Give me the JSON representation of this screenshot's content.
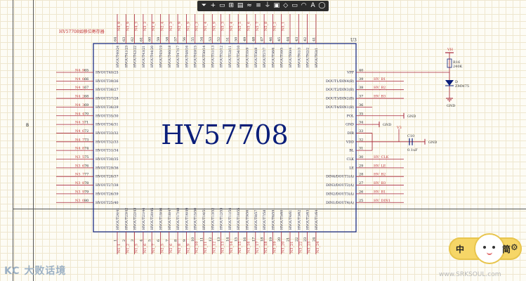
{
  "toolbar": {
    "tools": [
      {
        "name": "filter-tool",
        "glyph": "⏷"
      },
      {
        "name": "move-tool",
        "glyph": "+"
      },
      {
        "name": "select-tool",
        "glyph": "▭"
      },
      {
        "name": "align-tool",
        "glyph": "⊞"
      },
      {
        "name": "component-tool",
        "glyph": "▤"
      },
      {
        "name": "wire-tool",
        "glyph": "≈"
      },
      {
        "name": "bus-tool",
        "glyph": "≡"
      },
      {
        "name": "power-tool",
        "glyph": "⏚"
      },
      {
        "name": "port-tool",
        "glyph": "▣"
      },
      {
        "name": "directive-tool",
        "glyph": "◇"
      },
      {
        "name": "harness-tool",
        "glyph": "▭"
      },
      {
        "name": "arc-tool",
        "glyph": "◠"
      },
      {
        "name": "text-tool",
        "glyph": "A"
      },
      {
        "name": "shape-tool",
        "glyph": "◯"
      }
    ]
  },
  "sheet": {
    "zone_letter": "B"
  },
  "chip": {
    "title": "HV57708",
    "designator": "U3",
    "heading": "HV57708如移位寄存器",
    "colors": {
      "body": "#0b1e7a",
      "wire": "#a8263a",
      "net": "#c03030",
      "pinnum": "#222222",
      "pintext": "#1a1a3a"
    }
  },
  "top_pins": [
    {
      "num": "64",
      "pin": "HVOUT40/24",
      "net": "N4_9"
    },
    {
      "num": "63",
      "pin": "HVOUT41/23",
      "net": "N3_9"
    },
    {
      "num": "62",
      "pin": "HVOUT42/22",
      "net": "N4_3"
    },
    {
      "num": "61",
      "pin": "HVOUT43/21",
      "net": "N3_3"
    },
    {
      "num": "60",
      "pin": "HVOUT44/20",
      "net": "N3_4"
    },
    {
      "num": "59",
      "pin": "HVOUT45/19",
      "net": "N2_4"
    },
    {
      "num": "58",
      "pin": "HVOUT46/18",
      "net": "N2_3"
    },
    {
      "num": "57",
      "pin": "HVOUT47/17",
      "net": "N2_9"
    },
    {
      "num": "56",
      "pin": "HVOUT48/16",
      "net": "N1_9"
    },
    {
      "num": "55",
      "pin": "HVOUT49/15",
      "net": "N1_3"
    },
    {
      "num": "54",
      "pin": "HVOUT50/14",
      "net": "N1_4"
    },
    {
      "num": "53",
      "pin": "HVOUT51/13",
      "net": "N5_9"
    },
    {
      "num": "52",
      "pin": "HVOUT52/12",
      "net": "N5_3"
    },
    {
      "num": "51",
      "pin": "HVOUT53/11",
      "net": "N5_4"
    },
    {
      "num": "50",
      "pin": "HVOUT54/10",
      "net": "N5_5"
    },
    {
      "num": "49",
      "pin": "HVOUT55/9",
      "net": "N5_6"
    },
    {
      "num": "48",
      "pin": "HVOUT56/8",
      "net": "N5_7"
    },
    {
      "num": "47",
      "pin": "HVOUT57/7",
      "net": "N5_8"
    },
    {
      "num": "46",
      "pin": "HVOUT58/6",
      "net": "N5_2"
    },
    {
      "num": "45",
      "pin": "HVOUT59/5",
      "net": "N5_1"
    },
    {
      "num": "44",
      "pin": "HVOUT60/4",
      "net": ""
    },
    {
      "num": "43",
      "pin": "HVOUT61/3",
      "net": ""
    },
    {
      "num": "42",
      "pin": "HVOUT62/2",
      "net": ""
    },
    {
      "num": "41",
      "pin": "HVOUT63/1",
      "net": ""
    }
  ],
  "bottom_pins": [
    {
      "num": "1",
      "pin": "HVOUT24/41",
      "net": "N1_1"
    },
    {
      "num": "2",
      "pin": "HVOUT23/42",
      "net": "N1_2"
    },
    {
      "num": "3",
      "pin": "HVOUT22/43",
      "net": "N1_5"
    },
    {
      "num": "4",
      "pin": "HVOUT21/44",
      "net": "N1_6"
    },
    {
      "num": "5",
      "pin": "HVOUT20/45",
      "net": "N1_7"
    },
    {
      "num": "6",
      "pin": "HVOUT19/46",
      "net": "N2_5"
    },
    {
      "num": "7",
      "pin": "HVOUT18/47",
      "net": "N2_6"
    },
    {
      "num": "8",
      "pin": "HVOUT17/48",
      "net": "N2_8"
    },
    {
      "num": "9",
      "pin": "HVOUT16/49",
      "net": "N2_9"
    },
    {
      "num": "10",
      "pin": "HVOUT15/50",
      "net": "N2_10"
    },
    {
      "num": "11",
      "pin": "HVOUT14/51",
      "net": "N3_11"
    },
    {
      "num": "12",
      "pin": "HVOUT13/52",
      "net": "N3_12"
    },
    {
      "num": "13",
      "pin": "HVOUT12/53",
      "net": "N3_13"
    },
    {
      "num": "14",
      "pin": "HVOUT11/54",
      "net": "N3_14"
    },
    {
      "num": "15",
      "pin": "HVOUT10/55",
      "net": "N3_15"
    },
    {
      "num": "16",
      "pin": "HVOUT9/56",
      "net": "N3_16"
    },
    {
      "num": "17",
      "pin": "HVOUT8/57",
      "net": "N3_17"
    },
    {
      "num": "18",
      "pin": "HVOUT7/58",
      "net": "N3_18"
    },
    {
      "num": "19",
      "pin": "HVOUT6/59",
      "net": "N3_19"
    },
    {
      "num": "20",
      "pin": "HVOUT5/60",
      "net": "N3_20"
    },
    {
      "num": "21",
      "pin": "HVOUT4/61",
      "net": "N3_21"
    },
    {
      "num": "22",
      "pin": "HVOUT3/62",
      "net": "N3_22"
    },
    {
      "num": "23",
      "pin": "HVOUT2/63",
      "net": "N3_23"
    },
    {
      "num": "24",
      "pin": "HVOUT1/64",
      "net": "N3_24"
    }
  ],
  "left_pins": [
    {
      "num": "65",
      "pin": "HVOUT40/25",
      "net": "N4_9"
    },
    {
      "num": "66",
      "pin": "HVOUT39/26",
      "net": "N4_6"
    },
    {
      "num": "67",
      "pin": "HVOUT38/27",
      "net": "N4_1"
    },
    {
      "num": "68",
      "pin": "HVOUT37/28",
      "net": "N4_2"
    },
    {
      "num": "69",
      "pin": "HVOUT36/29",
      "net": "N4_3"
    },
    {
      "num": "70",
      "pin": "HVOUT35/30",
      "net": "N4_4"
    },
    {
      "num": "71",
      "pin": "HVOUT34/31",
      "net": "N4_5"
    },
    {
      "num": "72",
      "pin": "HVOUT33/32",
      "net": "N4_6"
    },
    {
      "num": "73",
      "pin": "HVOUT32/33",
      "net": "N4_7"
    },
    {
      "num": "74",
      "pin": "HVOUT31/34",
      "net": "N4_8"
    },
    {
      "num": "75",
      "pin": "HVOUT30/35",
      "net": "N3_5"
    },
    {
      "num": "76",
      "pin": "HVOUT29/36",
      "net": "N3_6"
    },
    {
      "num": "77",
      "pin": "HVOUT28/37",
      "net": "N3_7"
    },
    {
      "num": "78",
      "pin": "HVOUT27/38",
      "net": "N3_8"
    },
    {
      "num": "79",
      "pin": "HVOUT26/39",
      "net": "N3_9"
    },
    {
      "num": "80",
      "pin": "HVOUT25/40",
      "net": "N3_0"
    }
  ],
  "right_pins": [
    {
      "num": "40",
      "pin": "VPP",
      "net": ""
    },
    {
      "num": "39",
      "pin": "DOUT1/DIN4(B)",
      "net": "HV_B1"
    },
    {
      "num": "38",
      "pin": "DOUT2/DIN3(B)",
      "net": "HV_B2"
    },
    {
      "num": "37",
      "pin": "DOUT3/DIN2(B)",
      "net": "HV_B3"
    },
    {
      "num": "36",
      "pin": "DOUT4/DIN1(B)",
      "net": ""
    },
    {
      "num": "35",
      "pin": "POL",
      "net": ""
    },
    {
      "num": "34",
      "pin": "GND",
      "net": ""
    },
    {
      "num": "33",
      "pin": "DIR",
      "net": ""
    },
    {
      "num": "32",
      "pin": "VDD",
      "net": ""
    },
    {
      "num": "31",
      "pin": "BL",
      "net": ""
    },
    {
      "num": "30",
      "pin": "CLK",
      "net": "HV_CLK"
    },
    {
      "num": "29",
      "pin": "LE",
      "net": "HV_LE"
    },
    {
      "num": "28",
      "pin": "DIN4/DOUT1(A)",
      "net": "HV_B2"
    },
    {
      "num": "27",
      "pin": "DIN3/DOUT2(A)",
      "net": "HV_B3"
    },
    {
      "num": "26",
      "pin": "DIN2/DOUT3(A)",
      "net": "HV_B1"
    },
    {
      "num": "25",
      "pin": "DIN1/DOUT4(A)",
      "net": "HV_DIN1"
    }
  ],
  "parts": {
    "vh_label": "VH",
    "r16_name": "R16",
    "r16_value": "240K",
    "d_name": "D",
    "d_value": "ZMM75",
    "gnd_right": "GND",
    "gnd_pol": "GND",
    "gnd_34": "GND",
    "v3_label": "V3",
    "c10_name": "C10",
    "c10_value": "0.1uF",
    "gnd_c10": "GND"
  },
  "badge": {
    "left": "中",
    "right": "简"
  },
  "watermark": "KC 大败话境",
  "website": "www.SRKSOUL.com"
}
